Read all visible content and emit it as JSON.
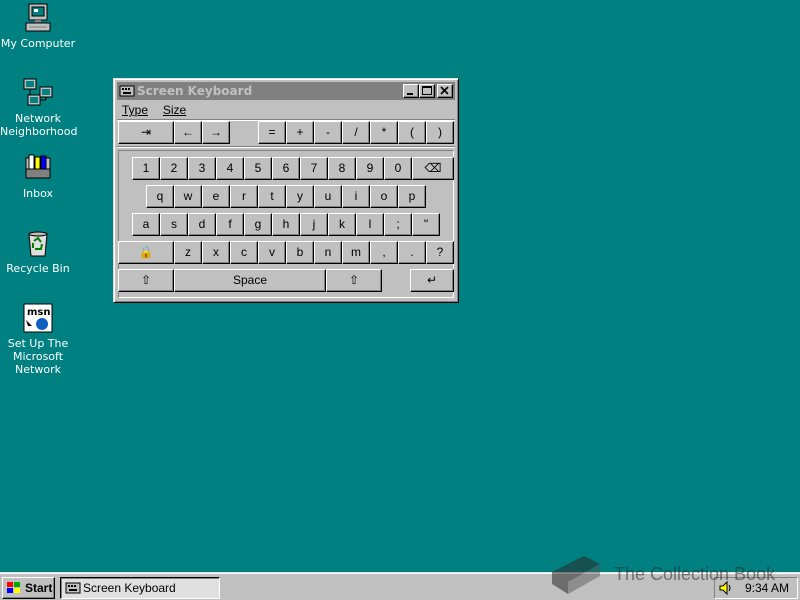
{
  "desktop": {
    "icons": [
      {
        "label": "My Computer",
        "icon": "computer-icon"
      },
      {
        "label": "Network Neighborhood",
        "icon": "network-icon"
      },
      {
        "label": "Inbox",
        "icon": "inbox-icon"
      },
      {
        "label": "Recycle Bin",
        "icon": "recycle-bin-icon"
      },
      {
        "label": "Set Up The Microsoft Network",
        "icon": "msn-icon"
      }
    ]
  },
  "window": {
    "title": "Screen Keyboard",
    "menu": [
      "Type",
      "Size"
    ],
    "toolbar_keys": [
      "⇥",
      "←",
      "→",
      "=",
      "+",
      "-",
      "/",
      "*",
      "(",
      ")"
    ],
    "rows": [
      [
        "1",
        "2",
        "3",
        "4",
        "5",
        "6",
        "7",
        "8",
        "9",
        "0",
        "⌫"
      ],
      [
        "q",
        "w",
        "e",
        "r",
        "t",
        "y",
        "u",
        "i",
        "o",
        "p"
      ],
      [
        "a",
        "s",
        "d",
        "f",
        "g",
        "h",
        "j",
        "k",
        "l",
        ";",
        "\""
      ],
      [
        "🔒",
        "z",
        "x",
        "c",
        "v",
        "b",
        "n",
        "m",
        ",",
        ".",
        "?"
      ],
      [
        "⇧",
        "Space",
        "⇧",
        "↵"
      ]
    ]
  },
  "taskbar": {
    "start_label": "Start",
    "task_label": "Screen Keyboard",
    "clock": "9:34 AM"
  },
  "watermark": {
    "text": "The Collection Book"
  },
  "colors": {
    "desktop": "#008080",
    "face": "#c0c0c0",
    "inactive_title": "#808080"
  }
}
